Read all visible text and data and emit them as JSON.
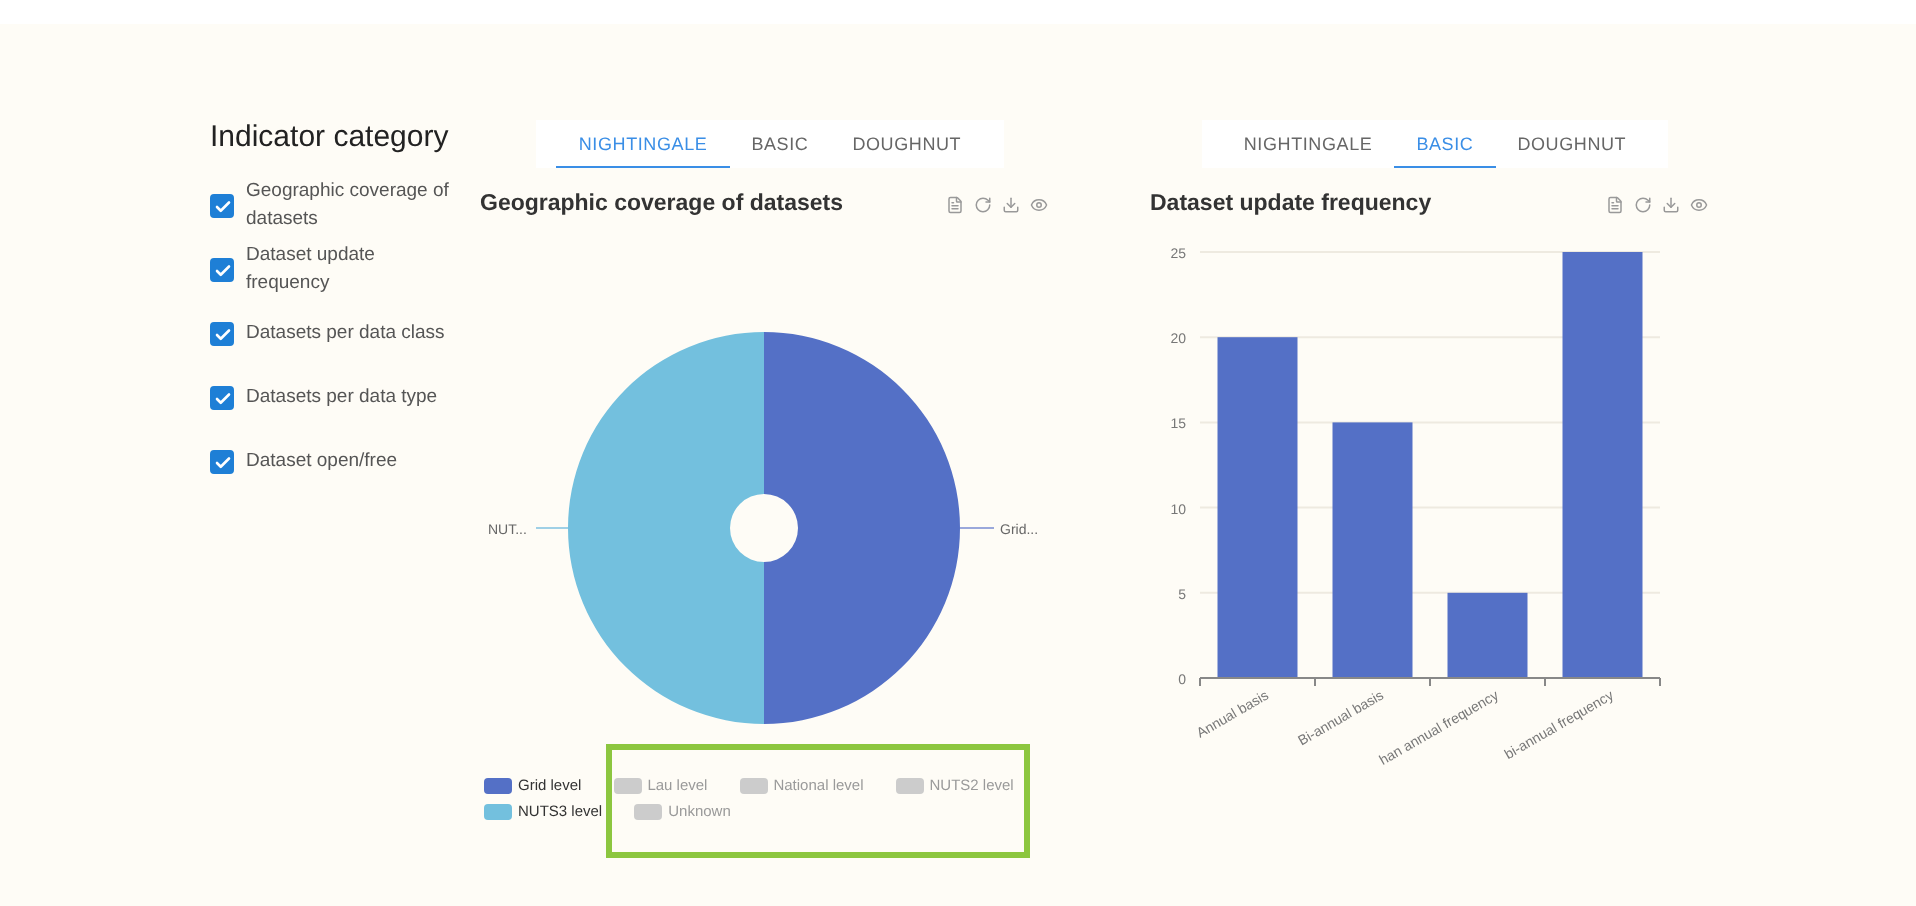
{
  "sidebar": {
    "title": "Indicator category",
    "items": [
      {
        "label": "Geographic coverage of datasets",
        "checked": true
      },
      {
        "label": "Dataset update frequency",
        "checked": true
      },
      {
        "label": "Datasets per data class",
        "checked": true
      },
      {
        "label": "Datasets per data type",
        "checked": true
      },
      {
        "label": "Dataset open/free",
        "checked": true
      }
    ]
  },
  "panels": [
    {
      "kind": "pie",
      "tabs": [
        {
          "label": "NIGHTINGALE",
          "selected": true
        },
        {
          "label": "BASIC",
          "selected": false
        },
        {
          "label": "DOUGHNUT",
          "selected": false
        }
      ],
      "title": "Geographic coverage of datasets",
      "slice_labels": [
        "NUT...",
        "Grid..."
      ],
      "legend": {
        "highlight_frame": true,
        "items": [
          {
            "label": "Grid level",
            "active": true,
            "color": "#5470c6"
          },
          {
            "label": "Lau level",
            "active": false
          },
          {
            "label": "National level",
            "active": false
          },
          {
            "label": "NUTS2 level",
            "active": false
          },
          {
            "label": "NUTS3 level",
            "active": true,
            "color": "#73c0de"
          },
          {
            "label": "Unknown",
            "active": false
          }
        ]
      }
    },
    {
      "kind": "bar",
      "tabs": [
        {
          "label": "NIGHTINGALE",
          "selected": false
        },
        {
          "label": "BASIC",
          "selected": true
        },
        {
          "label": "DOUGHNUT",
          "selected": false
        }
      ],
      "title": "Dataset update frequency",
      "chart_data": {
        "type": "bar",
        "categories": [
          "Annual basis",
          "Bi-annual basis",
          "han annual frequency",
          "bi-annual frequency"
        ],
        "series": [
          {
            "color": "#5470c6",
            "values": [
              20,
              15,
              5,
              25
            ]
          }
        ],
        "grid": true,
        "ylim": [
          0,
          25
        ],
        "yticks": [
          0,
          5,
          10,
          15,
          20,
          25
        ]
      }
    }
  ]
}
